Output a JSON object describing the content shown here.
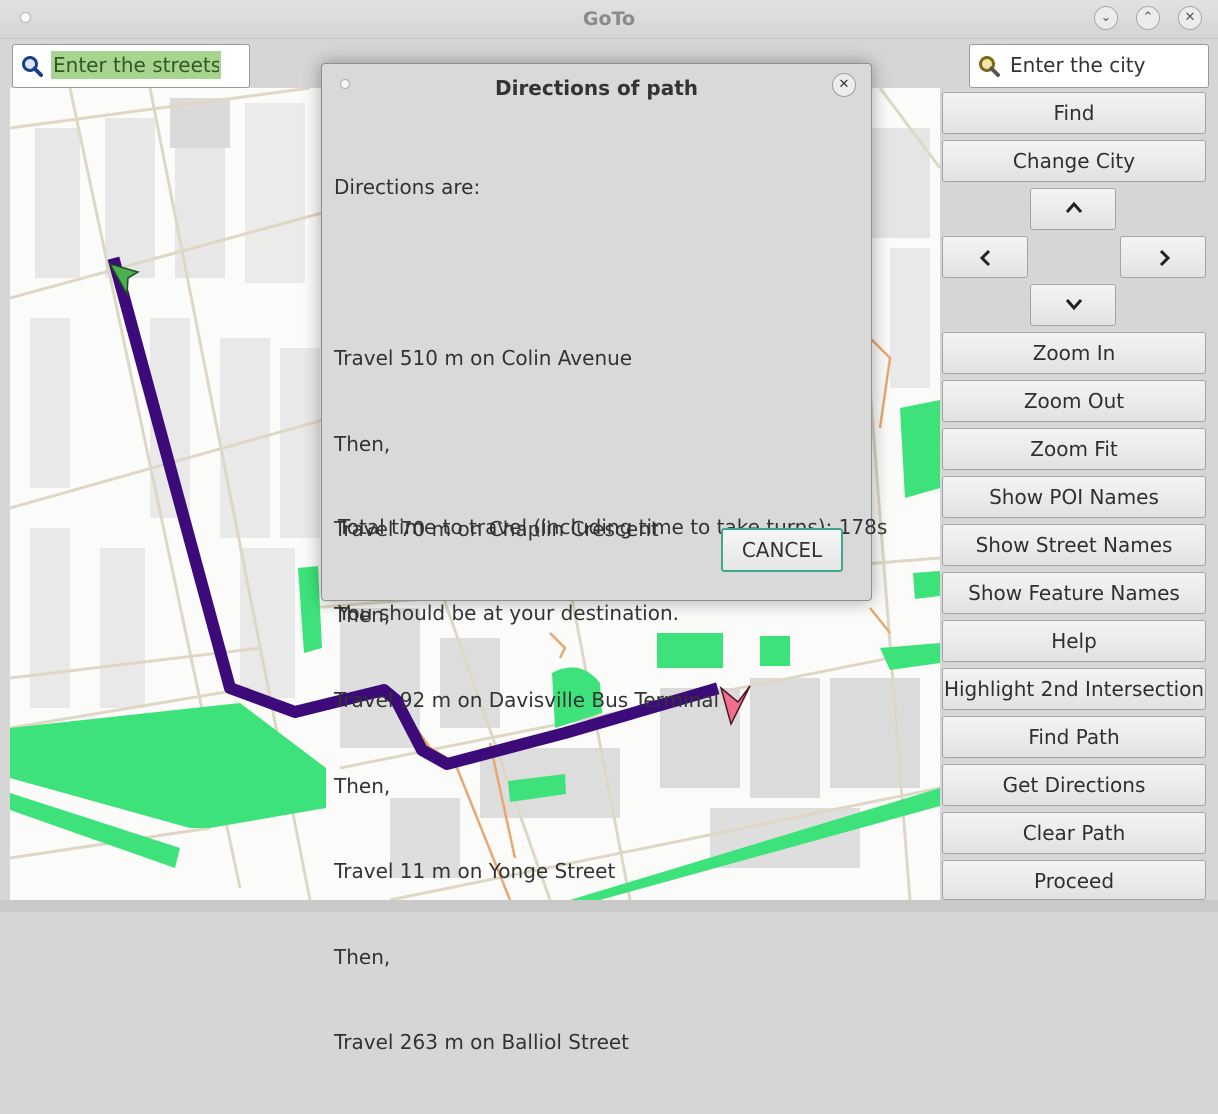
{
  "window": {
    "title": "GoTo"
  },
  "street_search": {
    "placeholder": "Enter the streets"
  },
  "city_search": {
    "placeholder": "Enter the city"
  },
  "sidebar": {
    "find": "Find",
    "change_city": "Change City",
    "zoom_in": "Zoom In",
    "zoom_out": "Zoom Out",
    "zoom_fit": "Zoom Fit",
    "show_poi_names": "Show POI Names",
    "show_street_names": "Show Street Names",
    "show_feature_names": "Show Feature Names",
    "help": "Help",
    "highlight_2nd_intersection": "Highlight 2nd Intersection",
    "find_path": "Find Path",
    "get_directions": "Get Directions",
    "clear_path": "Clear Path",
    "proceed": "Proceed"
  },
  "dialog": {
    "title": "Directions of path",
    "lines": [
      "Directions are:",
      "",
      "Travel 510 m on Colin Avenue",
      "Then,",
      "Travel 70 m on Chaplin Crescent",
      "Then,",
      "Travel 92 m on Davisville Bus Terminal",
      "Then,",
      "Travel 11 m on Yonge Street",
      "Then,",
      "Travel 263 m on Balliol Street"
    ],
    "total_time": "Total time to travel (including time to take turns): 178s",
    "arrival": "You should be at your destination.",
    "cancel_label": "CANCEL"
  },
  "map": {
    "route_color": "#3d0a7a",
    "park_color": "#3ee27a",
    "building_color": "#d4d4d4",
    "road_color": "#ddd8c6",
    "highway_color": "#e8a870",
    "start_marker_color": "#4caf50",
    "end_marker_color": "#f06e8e"
  }
}
